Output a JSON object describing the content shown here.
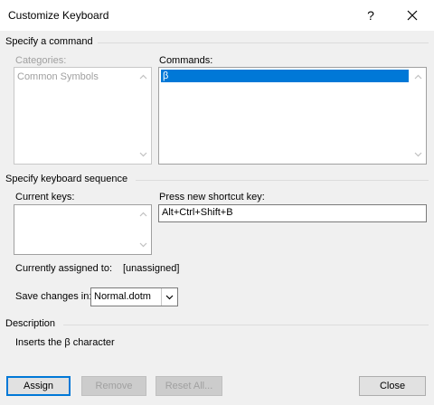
{
  "window": {
    "title": "Customize Keyboard",
    "help_glyph": "?",
    "close_glyph": "✕"
  },
  "specify_command": {
    "group_label": "Specify a command",
    "categories_label": "Categories:",
    "categories_items": [
      "Common Symbols"
    ],
    "commands_label": "Commands:",
    "commands_items": [
      "β"
    ]
  },
  "keyboard_sequence": {
    "group_label": "Specify keyboard sequence",
    "current_keys_label": "Current keys:",
    "new_shortcut_label": "Press new shortcut key:",
    "new_shortcut_value": "Alt+Ctrl+Shift+B",
    "currently_assigned_label": "Currently assigned to:",
    "currently_assigned_value": "[unassigned]"
  },
  "save_changes": {
    "label": "Save changes in:",
    "selected": "Normal.dotm"
  },
  "description": {
    "group_label": "Description",
    "text": "Inserts the β character"
  },
  "buttons": {
    "assign": "Assign",
    "remove": "Remove",
    "reset_all": "Reset All...",
    "close": "Close"
  }
}
